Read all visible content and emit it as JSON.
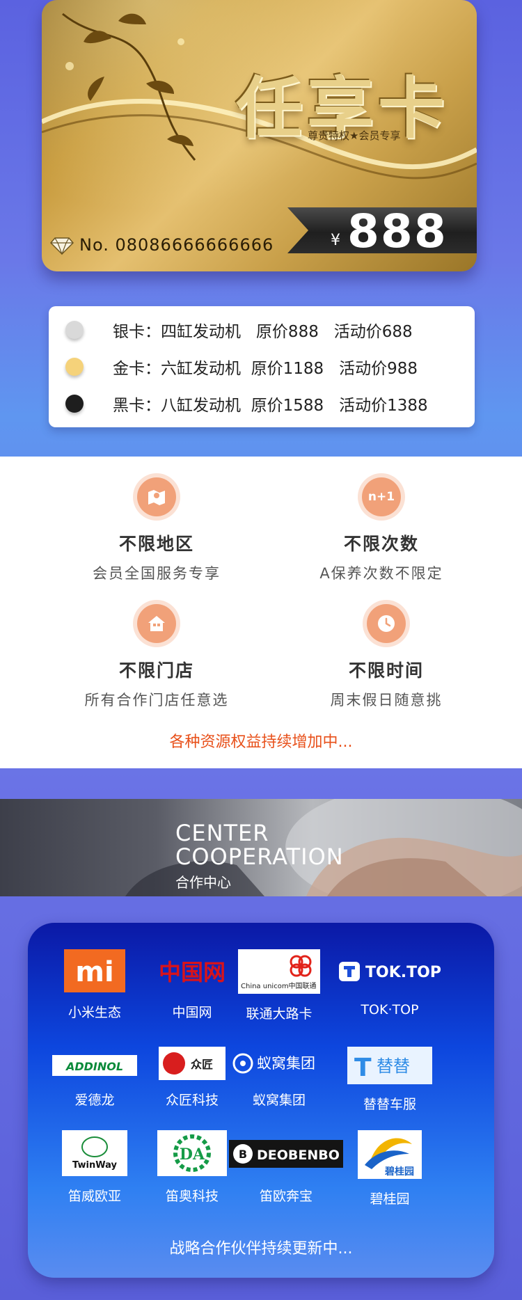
{
  "card": {
    "title": "任享卡",
    "subtitle": "尊贵特权★会员专享",
    "price_symbol": "¥",
    "price": "888",
    "number": "No. 08086666666666"
  },
  "tiers": [
    {
      "label": "银卡：四缸发动机   原价888   活动价688",
      "color": "#d9d9d9"
    },
    {
      "label": "金卡：六缸发动机  原价1188   活动价988",
      "color": "#f5d27a"
    },
    {
      "label": "黑卡：八缸发动机  原价1588   活动价1388",
      "color": "#1e1e1e"
    }
  ],
  "benefits": [
    {
      "icon": "map-icon",
      "title": "不限地区",
      "desc": "会员全国服务专享"
    },
    {
      "icon": "n-plus-one-icon",
      "icon_text": "n+1",
      "title": "不限次数",
      "desc": "A保养次数不限定"
    },
    {
      "icon": "store-icon",
      "title": "不限门店",
      "desc": "所有合作门店任意选"
    },
    {
      "icon": "clock-icon",
      "title": "不限时间",
      "desc": "周末假日随意挑"
    }
  ],
  "benefits_footer": "各种资源权益持续增加中...",
  "banner": {
    "line1": "CENTER",
    "line2": "COOPERATION",
    "cn": "合作中心"
  },
  "partners": [
    {
      "name": "小米生态",
      "logo": "mi-logo",
      "logo_text": "mi"
    },
    {
      "name": "中国网",
      "logo": "china-net-logo",
      "logo_text": "中国网"
    },
    {
      "name": "联通大路卡",
      "logo": "china-unicom-logo",
      "logo_text": "China unicom中国联通"
    },
    {
      "name": "TOK·TOP",
      "logo": "toktop-logo",
      "logo_text": "TOK.TOP"
    },
    {
      "name": "爱德龙",
      "logo": "addinol-logo",
      "logo_text": "ADDINOL"
    },
    {
      "name": "众匠科技",
      "logo": "zhongjiang-logo",
      "logo_text": "众匠"
    },
    {
      "name": "蚁窝集团",
      "logo": "ant-family-logo",
      "logo_text": "蚁窝集团"
    },
    {
      "name": "替替车服",
      "logo": "titi-logo",
      "logo_text": "替替"
    },
    {
      "name": "笛威欧亚",
      "logo": "twinway-logo",
      "logo_text": "TwinWay"
    },
    {
      "name": "笛奥科技",
      "logo": "da-logo",
      "logo_text": "DA"
    },
    {
      "name": "笛欧奔宝",
      "logo": "deobenbo-logo",
      "logo_text": "DEOBENBO"
    },
    {
      "name": "碧桂园",
      "logo": "country-garden-logo",
      "logo_text": "碧桂园"
    }
  ],
  "partners_footer": "战略合作伙伴持续更新中..."
}
